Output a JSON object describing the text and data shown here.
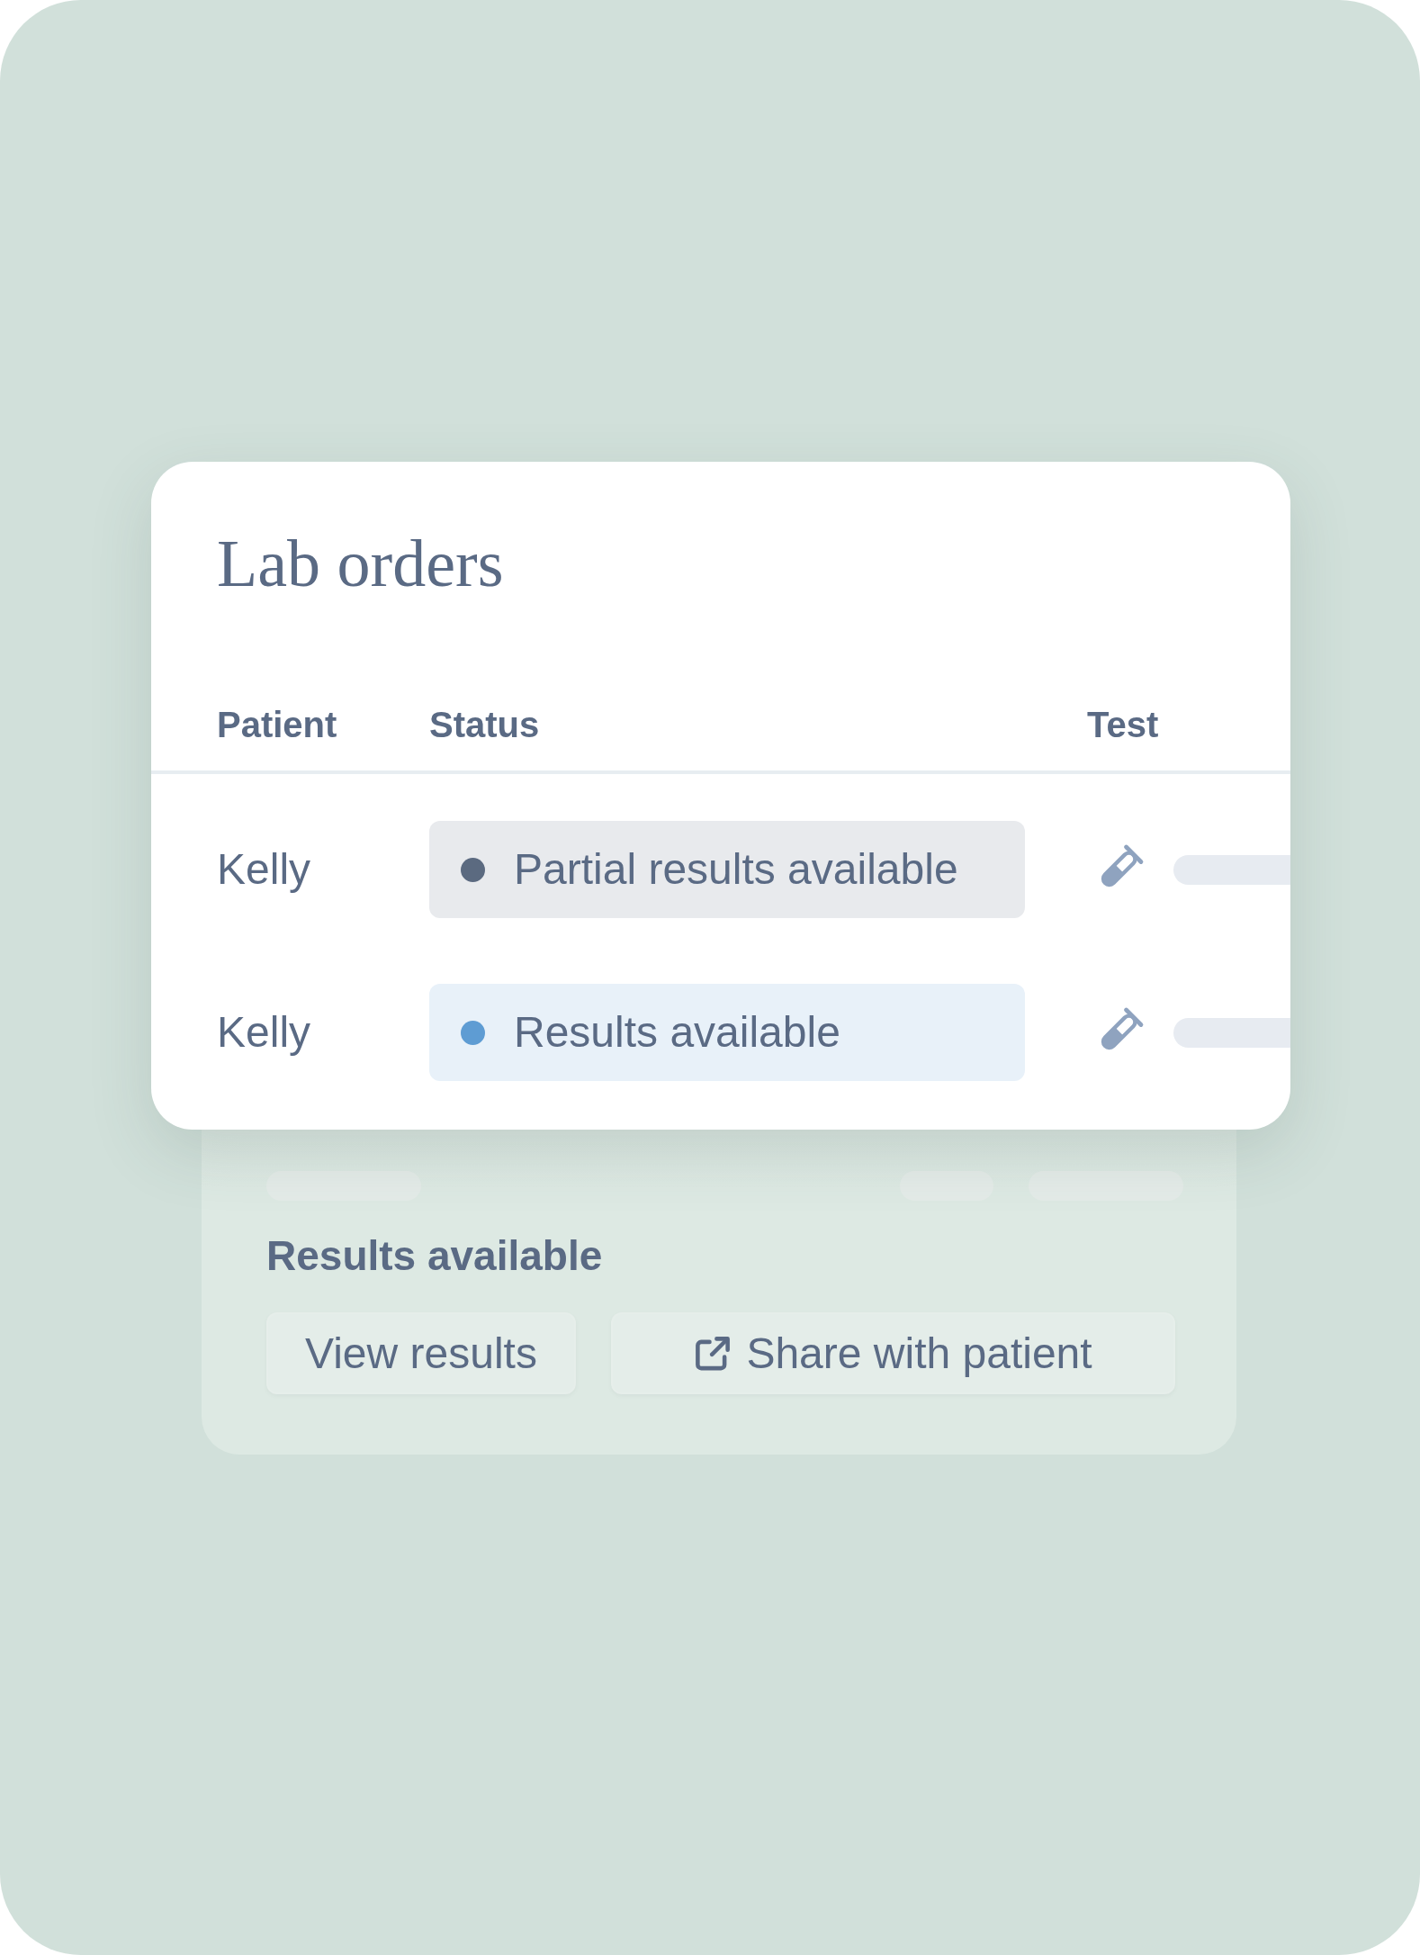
{
  "lab_orders": {
    "title": "Lab orders",
    "columns": [
      "Patient",
      "Status",
      "Test"
    ],
    "rows": [
      {
        "patient": "Kelly",
        "status": {
          "label": "Partial results available",
          "color": "#5b6a80"
        }
      },
      {
        "patient": "Kelly",
        "status": {
          "label": "Results available",
          "color": "#5e9cd3"
        }
      }
    ]
  },
  "detail_panel": {
    "title": "Results available",
    "buttons": [
      {
        "kind": "plain",
        "label": "View results"
      },
      {
        "kind": "share",
        "label": "Share with patient"
      }
    ]
  }
}
